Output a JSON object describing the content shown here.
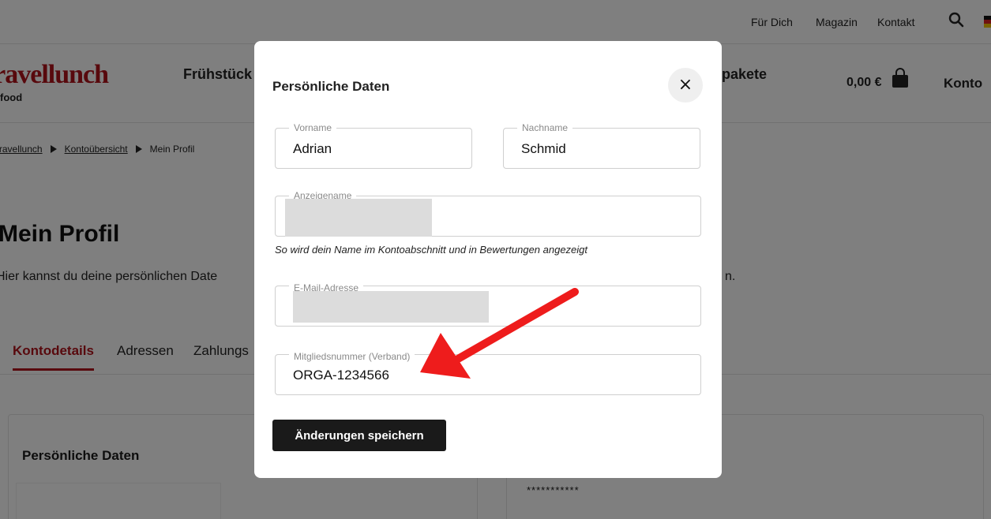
{
  "topbar": {
    "links": [
      "Für Dich",
      "Magazin",
      "Kontakt"
    ]
  },
  "header": {
    "logo_text": "Travellunch",
    "logo_sub": "food",
    "nav_left": "Frühstück",
    "nav_right": "pakete",
    "cart_price": "0,00 €",
    "account_label": "Konto"
  },
  "breadcrumb": {
    "items": [
      "Travellunch",
      "Kontoübersicht",
      "Mein Profil"
    ]
  },
  "page": {
    "title": "Mein Profil",
    "description": "Hier kannst du deine persönlichen Date",
    "description_end": "n."
  },
  "tabs": [
    "Kontodetails",
    "Adressen",
    "Zahlungs"
  ],
  "cards": {
    "personal_title": "Persönliche Daten",
    "password_mask": "***********"
  },
  "modal": {
    "title": "Persönliche Daten",
    "close_symbol": "×",
    "fields": {
      "first_name": {
        "label": "Vorname",
        "value": "Adrian"
      },
      "last_name": {
        "label": "Nachname",
        "value": "Schmid"
      },
      "display_name": {
        "label": "Anzeigename",
        "value": ""
      },
      "email": {
        "label": "E-Mail-Adresse",
        "value": ""
      },
      "member_number": {
        "label": "Mitgliedsnummer (Verband)",
        "value": "ORGA-1234566"
      }
    },
    "display_name_hint": "So wird dein Name im Kontoabschnitt und in Bewertungen angezeigt",
    "save_label": "Änderungen speichern"
  },
  "colors": {
    "brand": "#b0121b",
    "overlay": "rgba(0,0,0,0.5)",
    "annotation_arrow": "#ee1c1c",
    "button": "#1a1a1a"
  }
}
